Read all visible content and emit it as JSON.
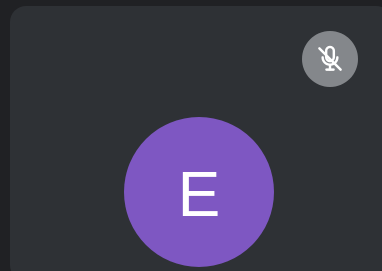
{
  "participant_tile": {
    "avatar_initial": "E",
    "avatar_color": "#7e57c2",
    "tile_background": "#2e3135",
    "mic_status_icon": "mic-off-icon",
    "mic_indicator_color": "#84878b"
  }
}
